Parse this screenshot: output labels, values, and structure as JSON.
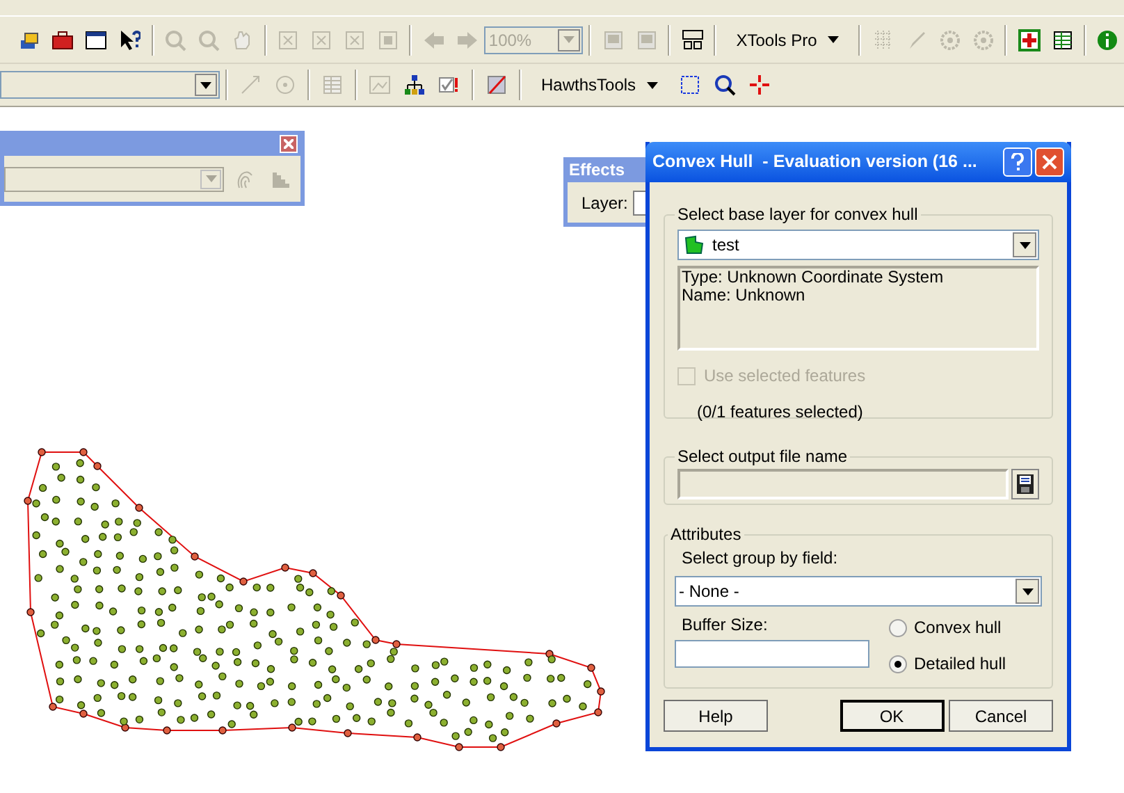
{
  "toolbar_1": {
    "items": [
      {
        "kind": "button",
        "disabled": false
      },
      {
        "kind": "button",
        "disabled": false
      },
      {
        "kind": "button",
        "disabled": false
      },
      {
        "kind": "button",
        "disabled": false
      },
      {
        "kind": "separator"
      },
      {
        "kind": "button",
        "disabled": true
      },
      {
        "kind": "button",
        "disabled": true
      },
      {
        "kind": "button",
        "disabled": true
      },
      {
        "kind": "separator"
      },
      {
        "kind": "button",
        "disabled": true
      },
      {
        "kind": "button",
        "disabled": true
      },
      {
        "kind": "button",
        "disabled": true
      },
      {
        "kind": "button",
        "disabled": true
      },
      {
        "kind": "separator"
      },
      {
        "kind": "button",
        "disabled": true
      },
      {
        "kind": "button",
        "disabled": true
      },
      {
        "kind": "combo",
        "value": "100%",
        "disabled": true
      },
      {
        "kind": "separator"
      },
      {
        "kind": "button",
        "disabled": true
      },
      {
        "kind": "button",
        "disabled": true
      },
      {
        "kind": "separator"
      },
      {
        "kind": "button",
        "disabled": false
      },
      {
        "kind": "separator"
      },
      {
        "kind": "menu",
        "label": "XTools Pro"
      },
      {
        "kind": "separator"
      },
      {
        "kind": "button",
        "disabled": true
      },
      {
        "kind": "button",
        "disabled": true
      },
      {
        "kind": "button",
        "disabled": true
      },
      {
        "kind": "button",
        "disabled": true
      },
      {
        "kind": "separator"
      },
      {
        "kind": "button",
        "disabled": false
      },
      {
        "kind": "button",
        "disabled": false
      },
      {
        "kind": "separator"
      },
      {
        "kind": "button",
        "disabled": false
      }
    ]
  },
  "toolbar_2": {
    "items": [
      {
        "kind": "combo",
        "disabled": false
      },
      {
        "kind": "separator"
      },
      {
        "kind": "button",
        "disabled": true
      },
      {
        "kind": "button",
        "disabled": true
      },
      {
        "kind": "separator"
      },
      {
        "kind": "button",
        "disabled": true
      },
      {
        "kind": "separator"
      },
      {
        "kind": "button",
        "disabled": true
      },
      {
        "kind": "button",
        "disabled": false
      },
      {
        "kind": "button",
        "disabled": false
      },
      {
        "kind": "separator"
      },
      {
        "kind": "button",
        "disabled": false
      },
      {
        "kind": "separator"
      },
      {
        "kind": "menu",
        "label": "HawthsTools"
      },
      {
        "kind": "button",
        "disabled": false
      },
      {
        "kind": "button",
        "disabled": false
      },
      {
        "kind": "button",
        "disabled": false
      }
    ]
  },
  "floating_toolbar": {
    "combo_disabled": true,
    "buttons": [
      {
        "disabled": true
      },
      {
        "disabled": true
      }
    ]
  },
  "effects_toolbar": {
    "title": "Effects",
    "layer_label": "Layer:"
  },
  "dialog": {
    "title": "Convex Hull  - Evaluation version (16 ...",
    "base_layer": {
      "legend": "Select base layer for convex hull",
      "value": "test",
      "info": [
        "Type: Unknown Coordinate System",
        "Name: Unknown"
      ],
      "use_selected": {
        "label": "Use selected features",
        "checked": false,
        "disabled": true
      },
      "selection_count": "(0/1 features selected)"
    },
    "output": {
      "legend": "Select output file name"
    },
    "attributes": {
      "legend": "Attributes",
      "group_label": "Select group by field:",
      "group_value": "- None -",
      "buffer_label": "Buffer Size:",
      "options": [
        {
          "label": "Convex hull",
          "selected": false
        },
        {
          "label": "Detailed hull",
          "selected": true
        }
      ]
    },
    "buttons": [
      {
        "label": "Help",
        "default": false
      },
      {
        "label": "OK",
        "default": true
      },
      {
        "label": "Cancel",
        "default": false
      }
    ]
  }
}
